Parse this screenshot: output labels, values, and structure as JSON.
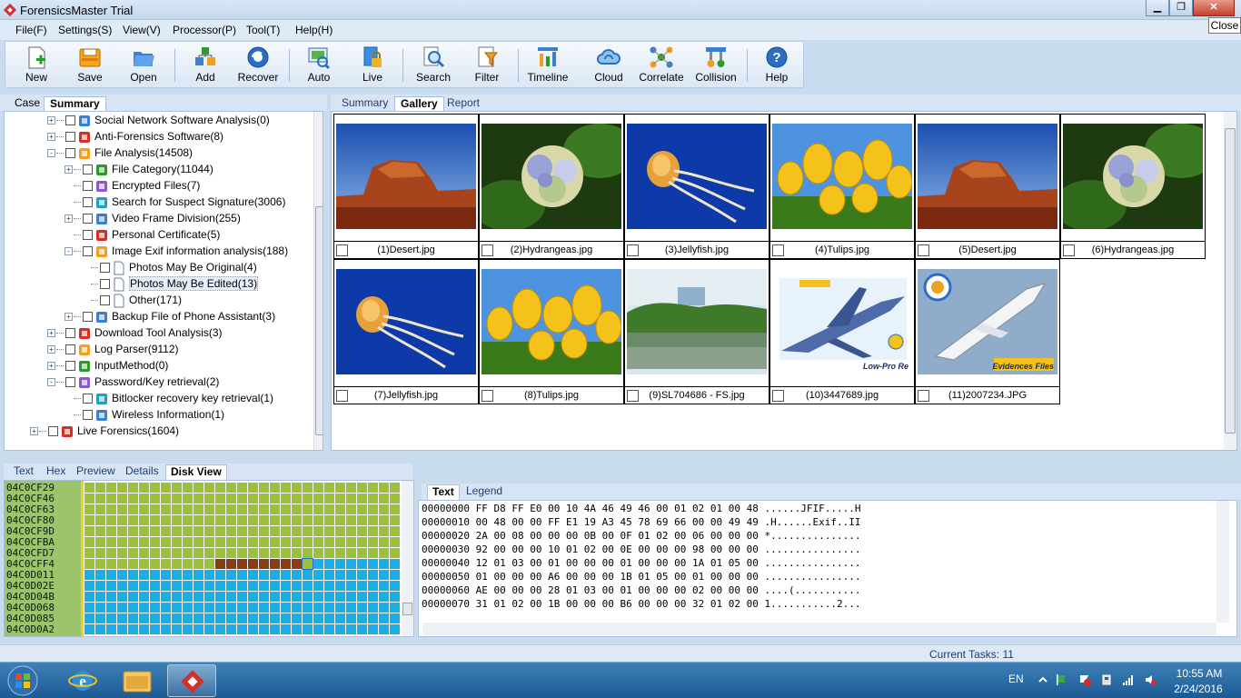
{
  "window": {
    "title": "ForensicsMaster Trial",
    "tooltip": "Close",
    "controls": {
      "minimize": "▁",
      "maximize": "❐",
      "close": "✕"
    }
  },
  "menu": [
    "File(F)",
    "Settings(S)",
    "View(V)",
    "Processor(P)",
    "Tool(T)",
    "Help(H)"
  ],
  "toolbar": [
    {
      "label": "New",
      "icon": "new-doc-icon"
    },
    {
      "label": "Save",
      "icon": "save-icon"
    },
    {
      "label": "Open",
      "icon": "folder-open-icon"
    },
    {
      "label": "Add",
      "icon": "add-source-icon"
    },
    {
      "label": "Recover",
      "icon": "recover-disc-icon"
    },
    {
      "label": "Auto",
      "icon": "auto-scan-icon"
    },
    {
      "label": "Live",
      "icon": "live-lock-icon"
    },
    {
      "label": "Search",
      "icon": "search-icon"
    },
    {
      "label": "Filter",
      "icon": "filter-icon"
    },
    {
      "label": "Timeline",
      "icon": "timeline-icon"
    },
    {
      "label": "Cloud",
      "icon": "cloud-icon"
    },
    {
      "label": "Correlate",
      "icon": "correlate-icon"
    },
    {
      "label": "Collision",
      "icon": "collision-icon"
    },
    {
      "label": "Help",
      "icon": "help-icon"
    }
  ],
  "left_tabs": [
    "Case",
    "Summary"
  ],
  "tree": [
    {
      "label": "Social Network Software Analysis(0)",
      "level": 1,
      "expander": "+",
      "icon": "globe-icon"
    },
    {
      "label": "Anti-Forensics Software(8)",
      "level": 1,
      "expander": "+",
      "icon": "anti-forensics-icon"
    },
    {
      "label": "File Analysis(14508)",
      "level": 1,
      "expander": "-",
      "icon": "file-analysis-icon"
    },
    {
      "label": "File Category(11044)",
      "level": 2,
      "expander": "+",
      "icon": "file-category-icon"
    },
    {
      "label": "Encrypted Files(7)",
      "level": 2,
      "expander": "",
      "icon": "encrypted-icon"
    },
    {
      "label": "Search for Suspect Signature(3006)",
      "level": 2,
      "expander": "",
      "icon": "search-signature-icon"
    },
    {
      "label": "Video Frame Division(255)",
      "level": 2,
      "expander": "+",
      "icon": "video-icon"
    },
    {
      "label": "Personal Certificate(5)",
      "level": 2,
      "expander": "",
      "icon": "certificate-icon"
    },
    {
      "label": "Image Exif information analysis(188)",
      "level": 2,
      "expander": "-",
      "icon": "image-exif-icon"
    },
    {
      "label": "Photos May Be Original(4)",
      "level": 3,
      "expander": "",
      "icon": "doc-icon"
    },
    {
      "label": "Photos May Be Edited(13)",
      "level": 3,
      "expander": "",
      "icon": "doc-icon",
      "selected": true
    },
    {
      "label": "Other(171)",
      "level": 3,
      "expander": "",
      "icon": "doc-icon"
    },
    {
      "label": "Backup File of Phone Assistant(3)",
      "level": 2,
      "expander": "+",
      "icon": "phone-icon"
    },
    {
      "label": "Download Tool Analysis(3)",
      "level": 1,
      "expander": "+",
      "icon": "download-icon"
    },
    {
      "label": "Log Parser(9112)",
      "level": 1,
      "expander": "+",
      "icon": "log-icon"
    },
    {
      "label": "InputMethod(0)",
      "level": 1,
      "expander": "+",
      "icon": "input-method-icon"
    },
    {
      "label": "Password/Key retrieval(2)",
      "level": 1,
      "expander": "-",
      "icon": "key-icon"
    },
    {
      "label": "Bitlocker recovery key retrieval(1)",
      "level": 2,
      "expander": "",
      "icon": "bitlocker-icon"
    },
    {
      "label": "Wireless Information(1)",
      "level": 2,
      "expander": "",
      "icon": "wireless-icon"
    },
    {
      "label": "Live Forensics(1604)",
      "level": 0,
      "expander": "+",
      "icon": "live-forensics-icon"
    }
  ],
  "right_tabs": [
    "Summary",
    "Gallery",
    "Report"
  ],
  "gallery": [
    {
      "name": "(1)Desert.jpg",
      "scene": "desert"
    },
    {
      "name": "(2)Hydrangeas.jpg",
      "scene": "hydrangeas"
    },
    {
      "name": "(3)Jellyfish.jpg",
      "scene": "jellyfish"
    },
    {
      "name": "(4)Tulips.jpg",
      "scene": "tulips"
    },
    {
      "name": "(5)Desert.jpg",
      "scene": "desert"
    },
    {
      "name": "(6)Hydrangeas.jpg",
      "scene": "hydrangeas"
    },
    {
      "name": "(7)Jellyfish.jpg",
      "scene": "jellyfish"
    },
    {
      "name": "(8)Tulips.jpg",
      "scene": "tulips"
    },
    {
      "name": "(9)SL704686 - FS.jpg",
      "scene": "lake"
    },
    {
      "name": "(10)3447689.jpg",
      "scene": "fighter-jet",
      "caption": "Low-Pro Re"
    },
    {
      "name": "(11)2007234.JPG",
      "scene": "airliner",
      "caption": "Evidences Files"
    }
  ],
  "bottom_tabs": [
    "Text",
    "Hex",
    "Preview",
    "Details",
    "Disk View"
  ],
  "disk_view": {
    "addresses": [
      "04C0CF29",
      "04C0CF46",
      "04C0CF63",
      "04C0CF80",
      "04C0CF9D",
      "04C0CFBA",
      "04C0CFD7",
      "04C0CFF4",
      "04C0D011",
      "04C0D02E",
      "04C0D04B",
      "04C0D068",
      "04C0D085",
      "04C0D0A2"
    ],
    "colors": {
      "used": "#99c23a",
      "free": "#19aee8",
      "selected": "#8b3a14"
    }
  },
  "hex_tabs": [
    "Text",
    "Legend"
  ],
  "hex_lines": [
    "00000000 FF D8 FF E0 00 10 4A 46 49 46 00 01 02 01 00 48 ......JFIF.....H",
    "00000010 00 48 00 00 FF E1 19 A3 45 78 69 66 00 00 49 49 .H......Exif..II",
    "00000020 2A 00 08 00 00 00 0B 00 0F 01 02 00 06 00 00 00 *...............",
    "00000030 92 00 00 00 10 01 02 00 0E 00 00 00 98 00 00 00 ................",
    "00000040 12 01 03 00 01 00 00 00 01 00 00 00 1A 01 05 00 ................",
    "00000050 01 00 00 00 A6 00 00 00 1B 01 05 00 01 00 00 00 ................",
    "00000060 AE 00 00 00 28 01 03 00 01 00 00 00 02 00 00 00 ....(...........",
    "00000070 31 01 02 00 1B 00 00 00 B6 00 00 00 32 01 02 00 1...........2..."
  ],
  "status": {
    "tasks": "Current Tasks: 11"
  },
  "taskbar": {
    "apps": [
      "start-orb-icon",
      "ie-icon",
      "explorer-icon",
      "forensicsmaster-icon"
    ],
    "lang": "EN",
    "time": "10:55 AM",
    "date": "2/24/2016"
  }
}
